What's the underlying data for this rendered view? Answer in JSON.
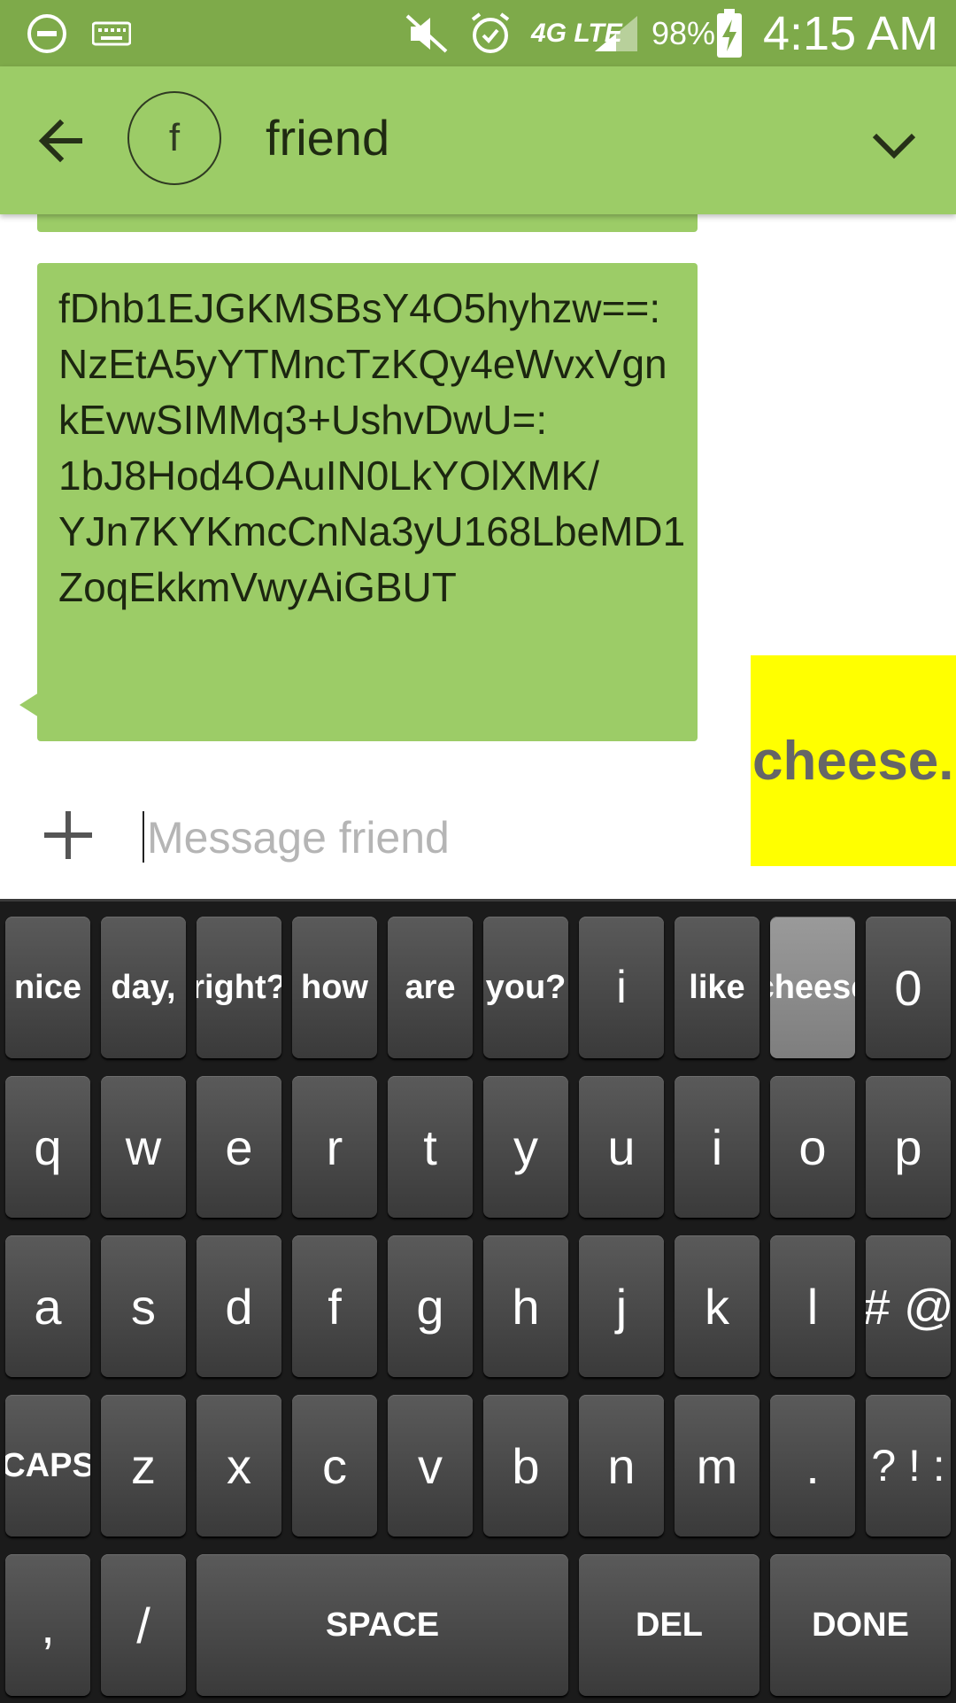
{
  "status_bar": {
    "battery": "98%",
    "time": "4:15 AM",
    "network": "4G LTE",
    "icons": [
      "do-not-disturb-icon",
      "keyboard-icon",
      "mute-icon",
      "alarm-icon",
      "network-4g-lte-icon",
      "signal-icon",
      "battery-charging-icon"
    ]
  },
  "header": {
    "avatar_letter": "f",
    "contact_name": "friend",
    "colors": {
      "bar": "#9ccc67",
      "status": "#7eaa4a"
    }
  },
  "conversation": {
    "message_text": "fDhb1EJGKMSBsY4O5hyhzw==:NzEtA5yYTMncTzKQy4eWvxVgnkEvwSIMMq3+UshvDwU=:\n1bJ8Hod4OAuIN0LkYOlXMK/\nYJn7KYKmcCnNa3yU168LbeMD1ZoqEkkmVwyAiGBUT",
    "bubble_color": "#9ccc67"
  },
  "suggestion": {
    "text": "cheese.",
    "background": "#ffff00"
  },
  "compose": {
    "placeholder": "Message friend",
    "value": ""
  },
  "keyboard": {
    "rows": [
      [
        "nice",
        "day,",
        "right?",
        "how",
        "are",
        "you?",
        "i",
        "like",
        "cheese",
        "0"
      ],
      [
        "q",
        "w",
        "e",
        "r",
        "t",
        "y",
        "u",
        "i",
        "o",
        "p"
      ],
      [
        "a",
        "s",
        "d",
        "f",
        "g",
        "h",
        "j",
        "k",
        "l",
        "# @"
      ],
      [
        "CAPS",
        "z",
        "x",
        "c",
        "v",
        "b",
        "n",
        "m",
        ".",
        "? ! :"
      ],
      [
        ",",
        "/",
        "SPACE",
        "DEL",
        "DONE"
      ]
    ],
    "highlighted": "cheese"
  }
}
